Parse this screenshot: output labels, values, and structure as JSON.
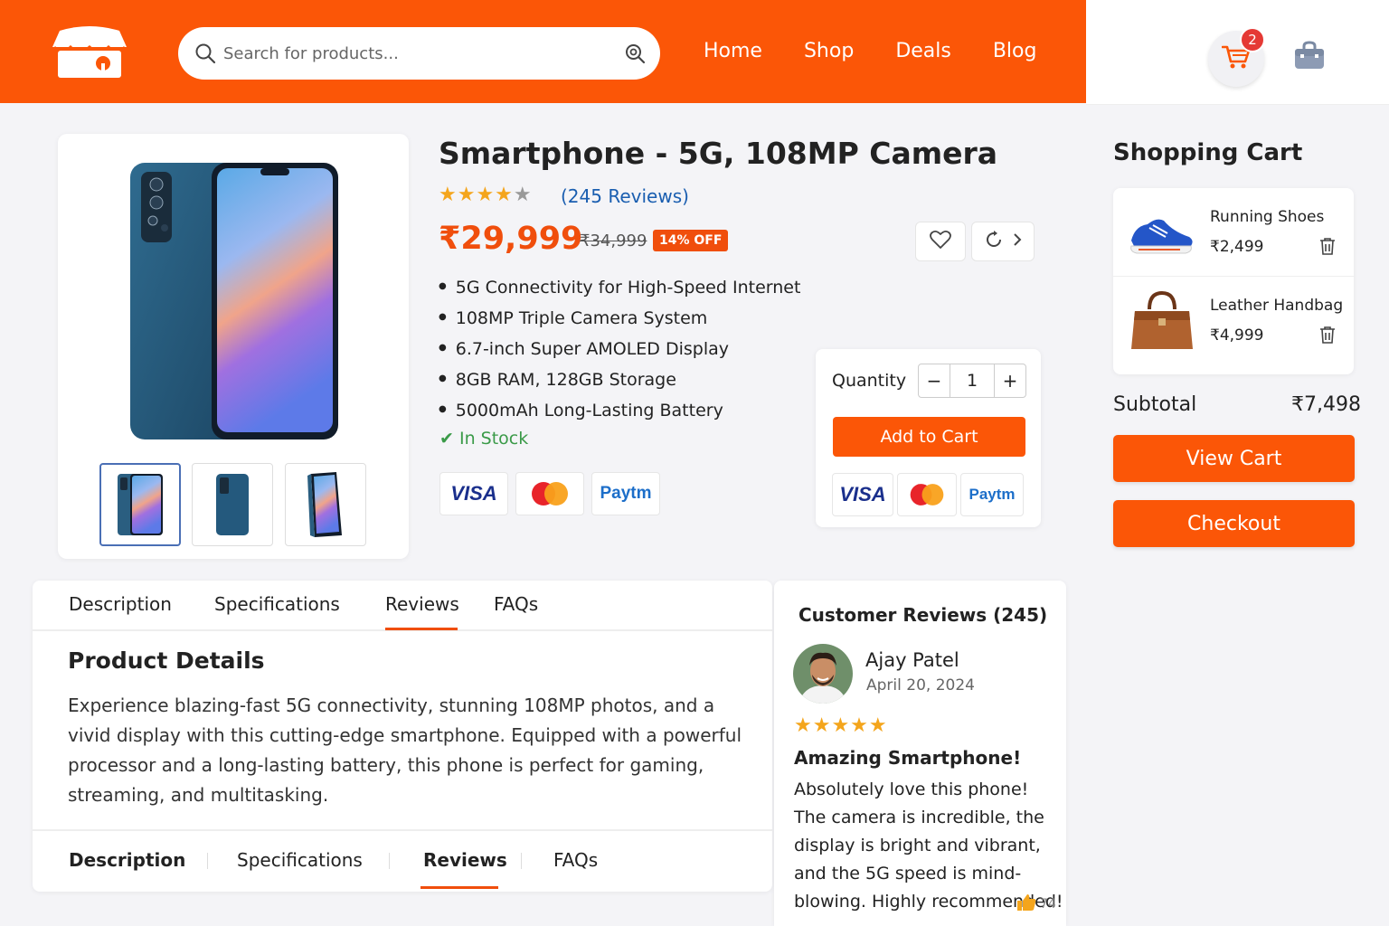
{
  "header": {
    "search_placeholder": "Search for products...",
    "nav": [
      "Home",
      "Shop",
      "Deals",
      "Blog"
    ],
    "cart_count": "2"
  },
  "product": {
    "title": "Smartphone - 5G, 108MP Camera",
    "rating": 4,
    "reviews_link": "(245 Reviews)",
    "price": "₹29,999",
    "old_price": "₹34,999",
    "discount": "14% OFF",
    "features": [
      "5G Connectivity for High-Speed Internet",
      "108MP Triple Camera System",
      "6.7-inch Super AMOLED Display",
      "8GB RAM, 128GB Storage",
      "5000mAh Long-Lasting Battery"
    ],
    "stock": "In Stock",
    "payments": [
      "VISA",
      "Paytm"
    ]
  },
  "purchase": {
    "quantity_label": "Quantity",
    "minus": "−",
    "quantity": "1",
    "plus": "+",
    "add_to_cart": "Add to Cart"
  },
  "cart": {
    "title": "Shopping Cart",
    "items": [
      {
        "name": "Running Shoes",
        "price": "₹2,499"
      },
      {
        "name": "Leather Handbag",
        "price": "₹4,999"
      }
    ],
    "subtotal_label": "Subtotal",
    "subtotal_value": "₹7,498",
    "view_cart": "View Cart",
    "checkout": "Checkout"
  },
  "tabs": [
    "Description",
    "Specifications",
    "Reviews",
    "FAQs"
  ],
  "details": {
    "title": "Product Details",
    "text": "Experience blazing-fast 5G connectivity, stunning 108MP photos, and a vivid display with this cutting-edge smartphone. Equipped with a powerful processor and a long-lasting battery, this phone is perfect for gaming, streaming, and multitasking."
  },
  "review": {
    "section_title": "Customer Reviews (245)",
    "name": "Ajay Patel",
    "date": "April 20, 2024",
    "rating": 5,
    "headline": "Amazing Smartphone!",
    "body": "Absolutely love this phone! The camera is incredible, the display is bright and vibrant, and the 5G speed is mind-blowing. Highly recommended!",
    "likes": "74"
  },
  "colors": {
    "brand": "#fb5607",
    "price": "#f04e0c",
    "link": "#1a5eb0",
    "stock": "#3a9a48",
    "star": "#f4a51c"
  }
}
